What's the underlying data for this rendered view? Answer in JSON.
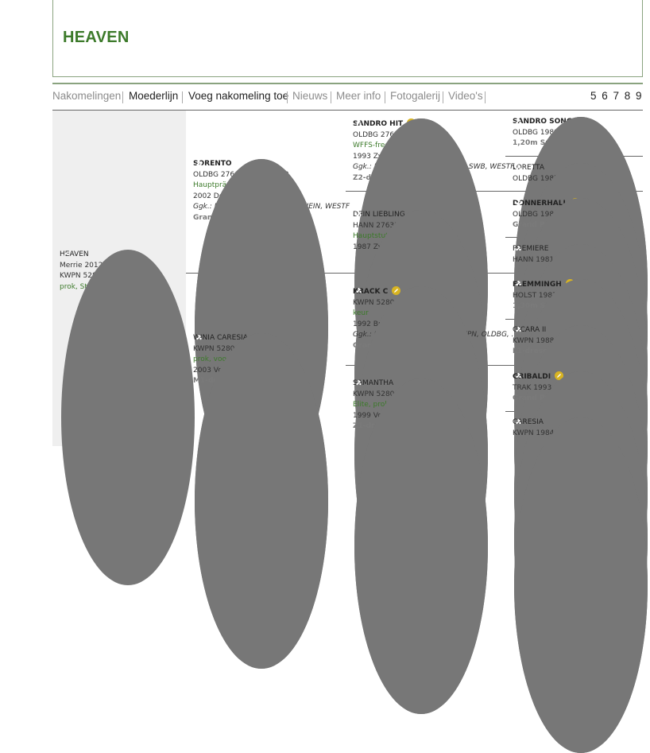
{
  "title": "HEAVEN",
  "nav": {
    "tabs": [
      "Nakomelingen",
      "Moederlijn",
      "Voeg nakomeling toe",
      "Nieuws",
      "Meer info",
      "Fotogalerij",
      "Video's"
    ],
    "pages": "5 6 7 8 9"
  },
  "horses": {
    "h0": {
      "name": "HEAVEN",
      "lines": [
        "Merrie 2012 Vos 1,65 m",
        "KWPN 528003201204637"
      ],
      "green": "prok, Stb."
    },
    "h1": {
      "name": "SORENTO",
      "lines": [
        "OLDBG 276433330248102"
      ],
      "green": "Hauptprämie",
      "line2": "2002 Donkerbruin 1,69 m",
      "ital": "Ggk.: BAVAR, HANN, OLDBG, RHEIN, WESTF",
      "gray": "Grand Prix"
    },
    "h2": {
      "name": "WINIA CARESIA",
      "lines": [
        "KWPN 528003200300116"
      ],
      "green": "prok, voorl.keur",
      "line2": "2003 Vos 1,67 m",
      "gray": "M1-dressuur"
    },
    "h3": {
      "name": "SANDRO HIT",
      "lines": [
        "OLDBG 276333330471993"
      ],
      "green": "WFFS-free",
      "line2": "1993 Zwart 1,72 m",
      "ital": "Ggk.: HANN, OLDBG, RHEIN, SF, SWB, WESTF...",
      "gray": "Z2-dressuur"
    },
    "h4": {
      "name": "DEIN LIEBLING",
      "lines": [
        "HANN 276331310655987"
      ],
      "green": "Hauptstutbuch",
      "line2": "1987 Zwart 1,70 m"
    },
    "h5": {
      "name": "KRACK C",
      "lines": [
        "KWPN 528003199205860"
      ],
      "green": "keur",
      "line2": "1992 Bruin 1,69 m",
      "ital": "Ggk.: BAVAR, HANN, HOLST, KWPN, OLDBG, ...",
      "gray": "Grand Prix"
    },
    "h6": {
      "name": "SAMANTHA",
      "lines": [
        "KWPN 528003199902583"
      ],
      "green": "Elite, prok",
      "line2": "1999 Vos 1,69 m",
      "gray": "Z1-dressuur"
    },
    "h7": {
      "name": "SANDRO SONG",
      "lines": [
        "OLDBG 1988"
      ],
      "gray": "1,20m Spr. Z2-dressuur"
    },
    "h8": {
      "name": "LORETTA",
      "lines": [
        "OLDBG 1987"
      ]
    },
    "h9": {
      "name": "DONNERHALL",
      "lines": [
        "OLDBG 1981"
      ],
      "gray": "Grand Prix"
    },
    "h10": {
      "name": "PREMIERE",
      "lines": [
        "HANN 1981"
      ]
    },
    "h11": {
      "name": "FLEMMINGH",
      "lines": [
        "HOLST 1987"
      ],
      "gray": "1,30m Spr."
    },
    "h12": {
      "name": "GICARA II",
      "lines": [
        "KWPN 1988"
      ],
      "gray": "L1-dressuur"
    },
    "h13": {
      "name": "GRIBALDI",
      "lines": [
        "TRAK 1993"
      ],
      "gray": "Grand Prix"
    },
    "h14": {
      "name": "CARESIA",
      "lines": [
        "KWPN 1984"
      ]
    }
  },
  "icons": {
    "gold": "medal-icon",
    "group": "offspring-icon",
    "edit": "edit-pencil-icon"
  },
  "colors": {
    "brand_green": "#3c7a2a",
    "border_green": "#8aa37f",
    "gold": "#d8b422"
  }
}
